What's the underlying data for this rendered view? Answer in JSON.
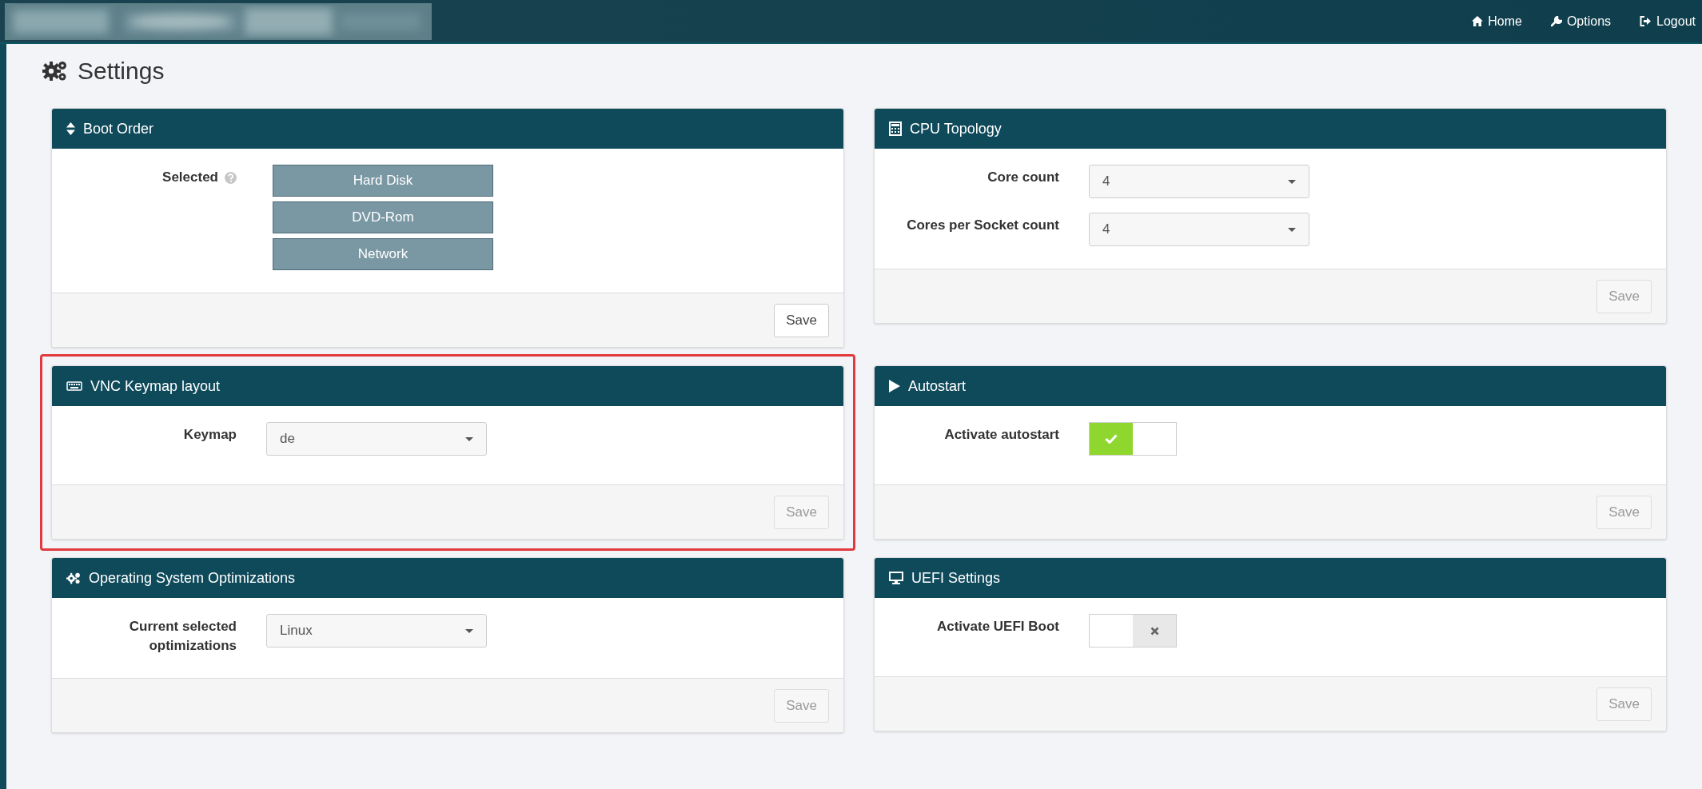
{
  "nav": [
    {
      "kind": "home",
      "label": "Home"
    },
    {
      "kind": "options",
      "label": "Options"
    },
    {
      "kind": "logout",
      "label": "Logout"
    }
  ],
  "page_title": "Settings",
  "panels": [
    {
      "title": "Boot Order",
      "kind": "boot",
      "fields": [
        {
          "kind": "order",
          "label": "Selected",
          "help": true,
          "items": [
            "Hard Disk",
            "DVD-Rom",
            "Network"
          ]
        }
      ],
      "save": {
        "label": "Save",
        "disabled": false
      }
    },
    {
      "title": "CPU Topology",
      "kind": "cpu",
      "fields": [
        {
          "kind": "select",
          "label": "Core count",
          "value": "4"
        },
        {
          "kind": "select",
          "label": "Cores per Socket count",
          "value": "4"
        }
      ],
      "save": {
        "label": "Save",
        "disabled": true
      }
    },
    {
      "title": "VNC Keymap layout",
      "kind": "keymap",
      "highlighted": true,
      "fields": [
        {
          "kind": "select",
          "label": "Keymap",
          "value": "de"
        }
      ],
      "save": {
        "label": "Save",
        "disabled": true
      }
    },
    {
      "title": "Autostart",
      "kind": "autostart",
      "fields": [
        {
          "kind": "toggle",
          "label": "Activate autostart",
          "on": true
        }
      ],
      "save": {
        "label": "Save",
        "disabled": true
      }
    },
    {
      "title": "Operating System Optimizations",
      "kind": "os",
      "fields": [
        {
          "kind": "select",
          "label": "Current selected optimizations",
          "value": "Linux"
        }
      ],
      "save": {
        "label": "Save",
        "disabled": true
      }
    },
    {
      "title": "UEFI Settings",
      "kind": "uefi",
      "fields": [
        {
          "kind": "toggle",
          "label": "Activate UEFI Boot",
          "on": false
        }
      ],
      "save": {
        "label": "Save",
        "disabled": true
      }
    }
  ]
}
